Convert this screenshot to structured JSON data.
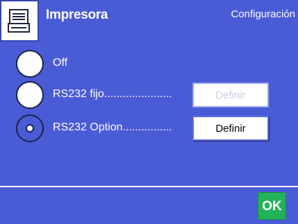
{
  "header": {
    "title": "Impresora",
    "section": "Configuración",
    "icon": "printer-icon"
  },
  "options": [
    {
      "label": "Off",
      "selected": false,
      "button": ""
    },
    {
      "label": "RS232 fijo......................",
      "selected": false,
      "button": "Definir",
      "button_enabled": false
    },
    {
      "label": "RS232 Option................",
      "selected": true,
      "button": "Definir",
      "button_enabled": true
    }
  ],
  "footer": {
    "ok_label": "OK"
  },
  "colors": {
    "panel": "#4a5bd6",
    "ok": "#23b35a"
  }
}
